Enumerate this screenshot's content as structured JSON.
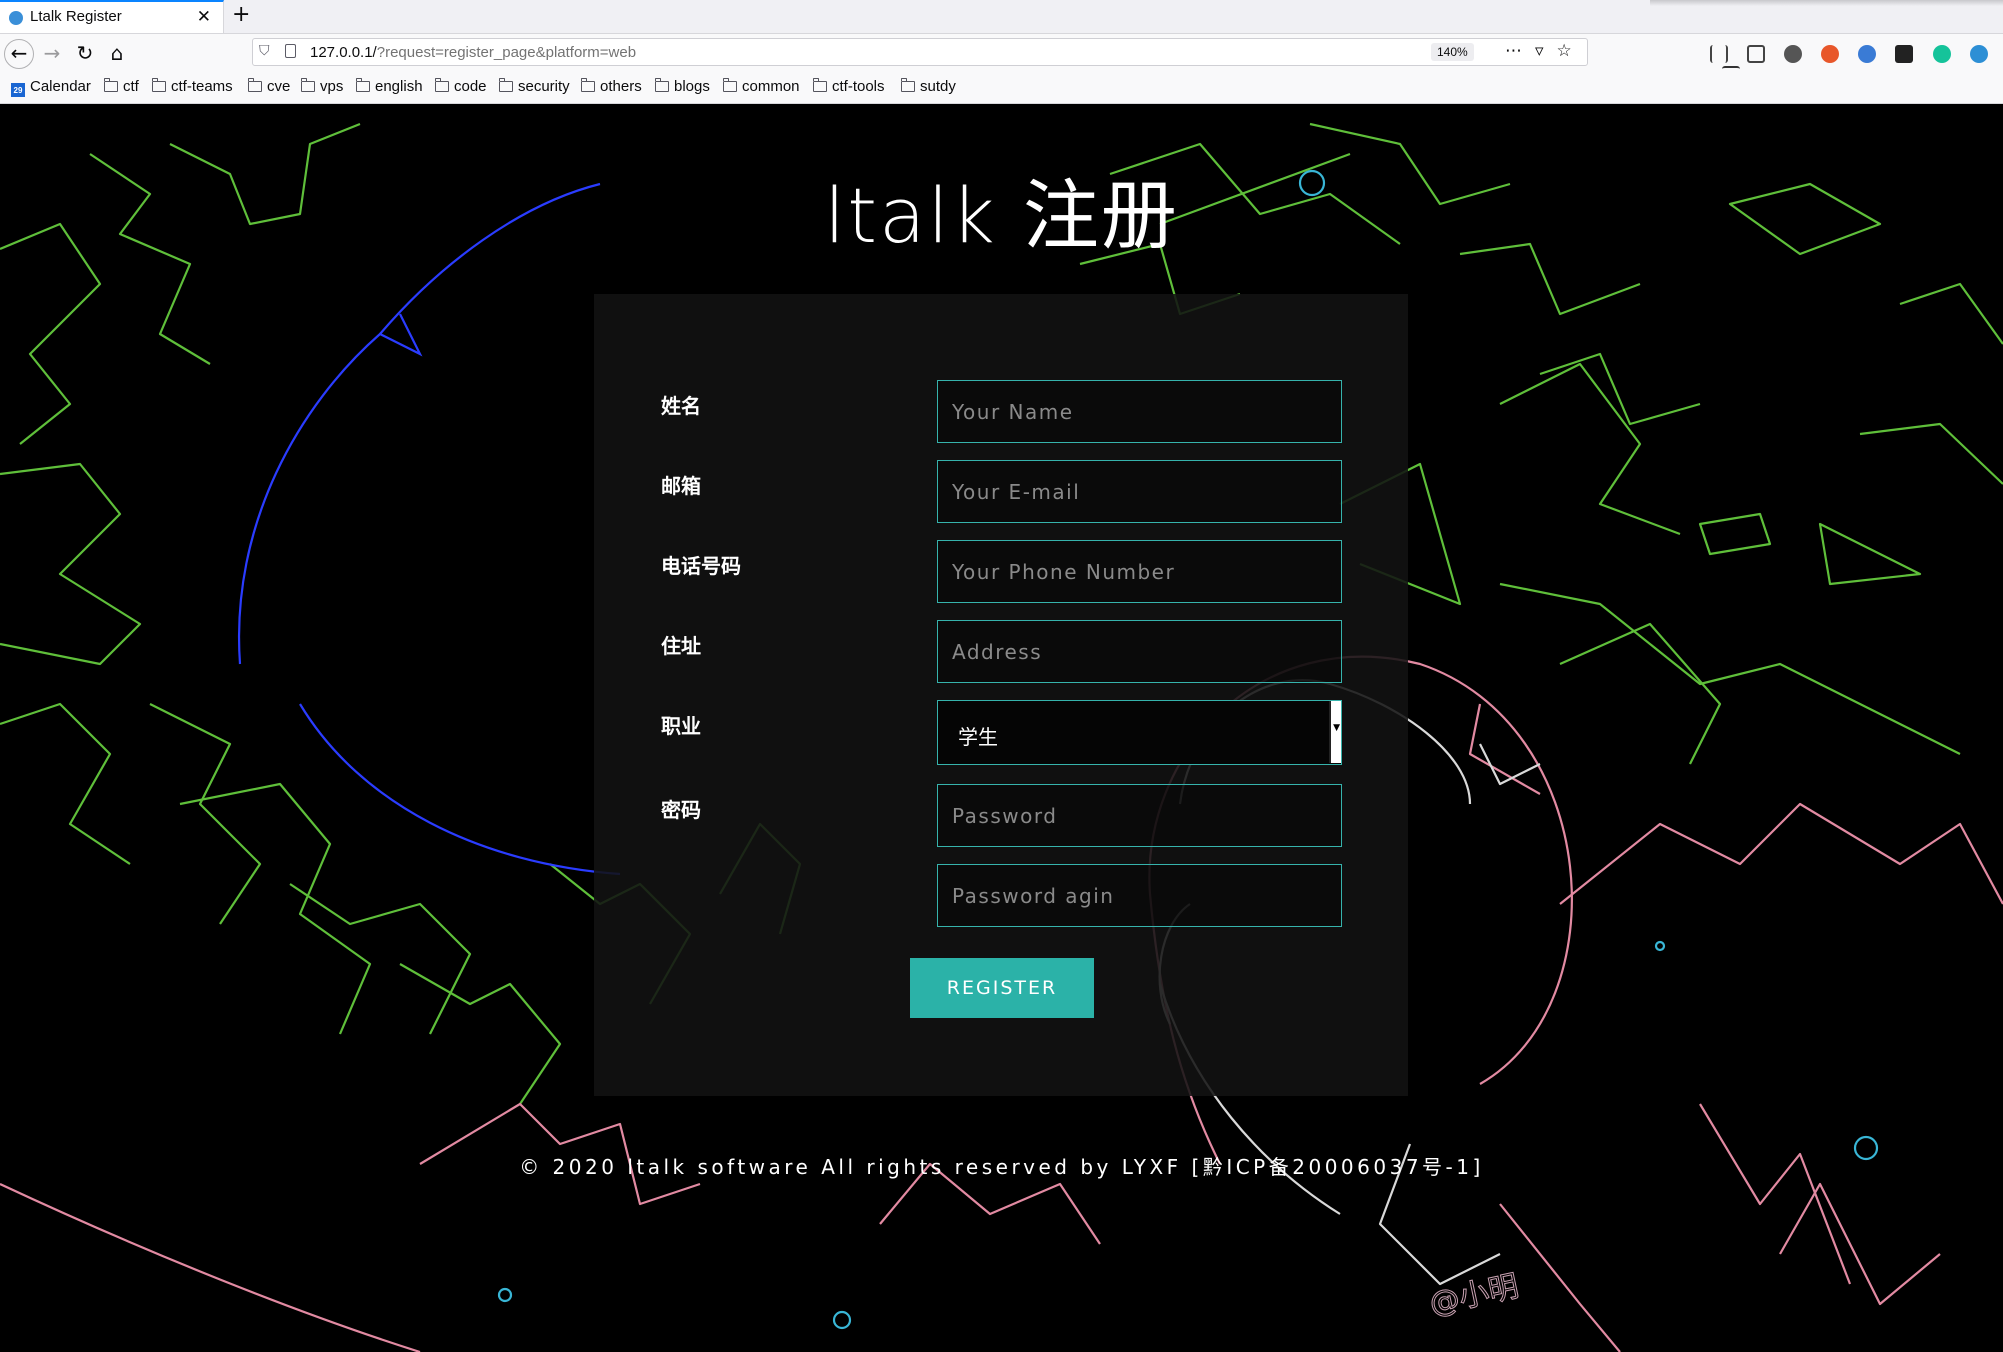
{
  "browser": {
    "tab_title": "Ltalk Register",
    "url_host": "127.0.0.1/",
    "url_path": "?request=register_page&platform=web",
    "zoom": "140%",
    "bookmarks": [
      "Calendar",
      "ctf",
      "ctf-teams",
      "cve",
      "vps",
      "english",
      "code",
      "security",
      "others",
      "blogs",
      "common",
      "ctf-tools",
      "sutdy"
    ]
  },
  "page": {
    "title": "ltalk 注册",
    "fields": [
      {
        "label": "姓名",
        "placeholder": "Your Name"
      },
      {
        "label": "邮箱",
        "placeholder": "Your E-mail"
      },
      {
        "label": "电话号码",
        "placeholder": "Your Phone Number"
      },
      {
        "label": "住址",
        "placeholder": "Address"
      },
      {
        "label": "职业",
        "value": "学生"
      },
      {
        "label": "密码",
        "placeholder": "Password"
      },
      {
        "label": "",
        "placeholder": "Password agin"
      }
    ],
    "register_label": "REGISTER",
    "footer": "© 2020 ltalk software All rights reserved by LYXF [黔ICP备20006037号-1]",
    "signature": "@小明"
  },
  "colors": {
    "accent": "#2bb2a8",
    "input_border": "#36b3ac",
    "background": "#000000"
  }
}
